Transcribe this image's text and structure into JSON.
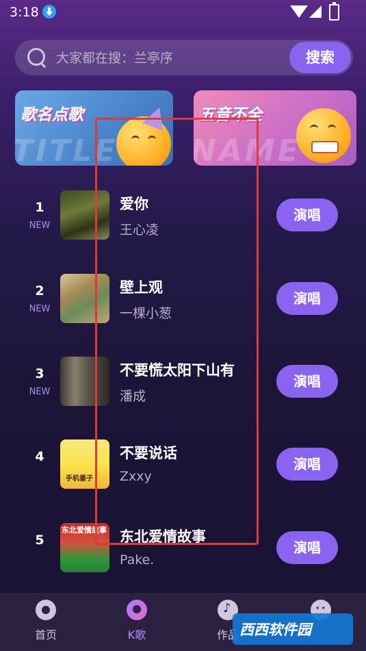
{
  "status_bar": {
    "time": "3:18"
  },
  "search": {
    "placeholder": "大家都在搜：兰亭序",
    "button": "搜索"
  },
  "banners": [
    {
      "title": "歌名点歌",
      "bg_text": "TITLE"
    },
    {
      "title": "五音不全",
      "bg_text": "NAME"
    }
  ],
  "songs": [
    {
      "rank": "1",
      "badge": "NEW",
      "title": "爱你",
      "artist": "王心凌",
      "action": "演唱"
    },
    {
      "rank": "2",
      "badge": "NEW",
      "title": "壁上观",
      "artist": "一棵小葱",
      "action": "演唱"
    },
    {
      "rank": "3",
      "badge": "NEW",
      "title": "不要慌太阳下山有",
      "artist": "潘成",
      "action": "演唱"
    },
    {
      "rank": "4",
      "badge": "",
      "title": "不要说话",
      "artist": "Zxxy",
      "action": "演唱"
    },
    {
      "rank": "5",
      "badge": "",
      "title": "东北爱情故事",
      "artist": "Pake.",
      "action": "演唱"
    }
  ],
  "covers": {
    "song4_label": "手机番子",
    "song5_label": "东北爱情故事"
  },
  "nav": [
    {
      "label": "首页"
    },
    {
      "label": "K歌"
    },
    {
      "label": "作品"
    },
    {
      "label": ""
    }
  ],
  "watermark": {
    "text": "西西软件园"
  },
  "colors": {
    "accent": "#8a63f0",
    "highlight": "#e03a36",
    "new_badge": "#a98ef0"
  }
}
